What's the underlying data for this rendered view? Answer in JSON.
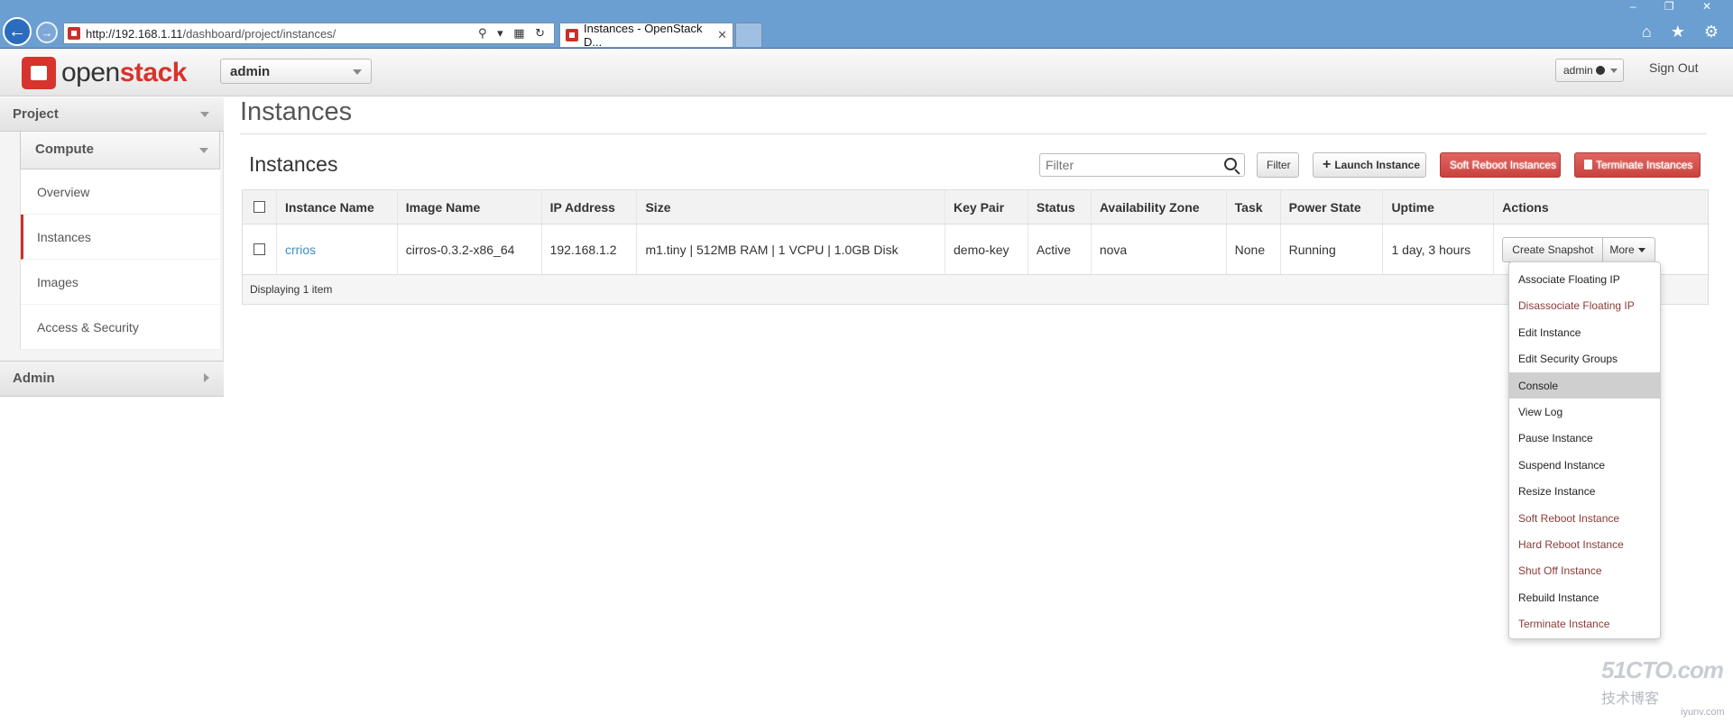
{
  "browser": {
    "url_host": "http://192.168.1.11",
    "url_path": "/dashboard/project/instances/",
    "tab_title": "Instances - OpenStack D...",
    "address_controls": "⚲ ▾ ▦ ↻",
    "window_controls": "– ❐ ✕",
    "toolbar_icons": "⌂ ★ ⚙"
  },
  "header": {
    "logo_prefix": "open",
    "logo_suffix": "stack",
    "project": "admin",
    "user": "admin",
    "sign_out": "Sign Out"
  },
  "sidebar": {
    "project_label": "Project",
    "compute_label": "Compute",
    "items": [
      {
        "label": "Overview"
      },
      {
        "label": "Instances"
      },
      {
        "label": "Images"
      },
      {
        "label": "Access & Security"
      }
    ],
    "admin_label": "Admin"
  },
  "main": {
    "page_title": "Instances",
    "panel_title": "Instances",
    "filter_placeholder": "Filter",
    "filter_button": "Filter",
    "launch_button": "Launch Instance",
    "soft_reboot_button": "Soft Reboot Instances",
    "terminate_button": "Terminate Instances"
  },
  "table": {
    "columns": [
      "Instance Name",
      "Image Name",
      "IP Address",
      "Size",
      "Key Pair",
      "Status",
      "Availability Zone",
      "Task",
      "Power State",
      "Uptime",
      "Actions"
    ],
    "rows": [
      {
        "name": "crrios",
        "image": "cirros-0.3.2-x86_64",
        "ip": "192.168.1.2",
        "size": "m1.tiny | 512MB RAM | 1 VCPU | 1.0GB Disk",
        "key_pair": "demo-key",
        "status": "Active",
        "zone": "nova",
        "task": "None",
        "power": "Running",
        "uptime": "1 day, 3 hours",
        "snapshot_button": "Create Snapshot",
        "more_button": "More"
      }
    ],
    "footer": "Displaying 1 item"
  },
  "actions_menu": [
    {
      "label": "Associate Floating IP",
      "danger": false
    },
    {
      "label": "Disassociate Floating IP",
      "danger": true
    },
    {
      "label": "Edit Instance",
      "danger": false
    },
    {
      "label": "Edit Security Groups",
      "danger": false
    },
    {
      "label": "Console",
      "danger": false,
      "hover": true
    },
    {
      "label": "View Log",
      "danger": false
    },
    {
      "label": "Pause Instance",
      "danger": false
    },
    {
      "label": "Suspend Instance",
      "danger": false
    },
    {
      "label": "Resize Instance",
      "danger": false
    },
    {
      "label": "Soft Reboot Instance",
      "danger": true
    },
    {
      "label": "Hard Reboot Instance",
      "danger": true
    },
    {
      "label": "Shut Off Instance",
      "danger": true
    },
    {
      "label": "Rebuild Instance",
      "danger": false
    },
    {
      "label": "Terminate Instance",
      "danger": true
    }
  ],
  "watermark": {
    "line1": "51CTO.com",
    "line2": "技术博客",
    "line3": "iyunv.com"
  },
  "colors": {
    "brand_red": "#d6342c",
    "link_blue": "#3d8fc4",
    "danger_text": "#8a3b36",
    "danger_button": "#c9433e"
  }
}
